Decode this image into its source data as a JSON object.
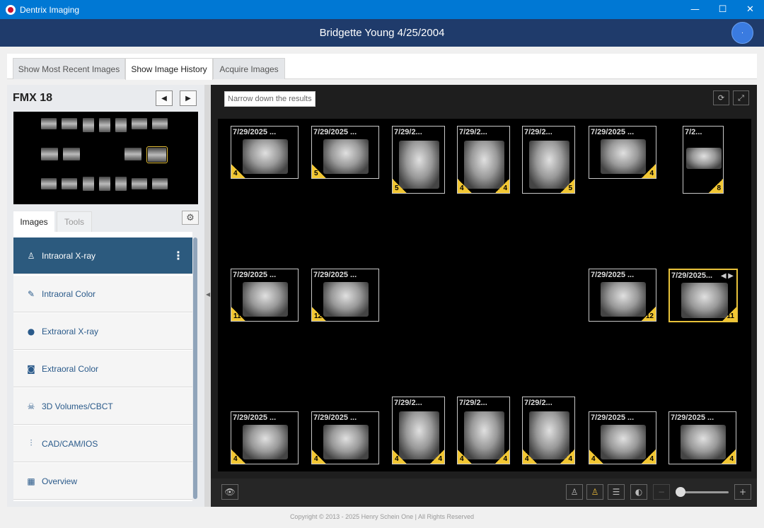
{
  "window": {
    "title": "Dentrix Imaging",
    "minimize": "—",
    "maximize": "☐",
    "close": "✕"
  },
  "patient": {
    "name_dob": "Bridgette Young 4/25/2004",
    "avatar_text": "·"
  },
  "tabs": [
    {
      "label": "Show Most Recent Images"
    },
    {
      "label": "Show Image History"
    },
    {
      "label": "Acquire Images"
    }
  ],
  "fmx": {
    "title": "FMX 18",
    "prev": "◀",
    "next": "▶"
  },
  "panel_tabs": {
    "images": "Images",
    "tools": "Tools",
    "gear": "⚙"
  },
  "categories": [
    {
      "label": "Intraoral X-ray",
      "icon": "tooth-icon",
      "glyph": "♙",
      "menu": "⋮"
    },
    {
      "label": "Intraoral Color",
      "icon": "brush-icon",
      "glyph": "✎"
    },
    {
      "label": "Extraoral X-ray",
      "icon": "head-icon",
      "glyph": "●"
    },
    {
      "label": "Extraoral Color",
      "icon": "camera-icon",
      "glyph": "◙"
    },
    {
      "label": "3D Volumes/CBCT",
      "icon": "skull-icon",
      "glyph": "☠"
    },
    {
      "label": "CAD/CAM/IOS",
      "icon": "implant-icon",
      "glyph": "⫶"
    },
    {
      "label": "Overview",
      "icon": "grid-icon",
      "glyph": "▦"
    }
  ],
  "viewer": {
    "filter_placeholder": "Narrow down the results",
    "refresh": "⟳",
    "fullscreen": "⤢",
    "thumbs": [
      {
        "date": "7/29/2025 ...",
        "bl": "4",
        "br": ""
      },
      {
        "date": "7/29/2025 ...",
        "bl": "5",
        "br": ""
      },
      {
        "date": "7/29/2...",
        "bl": "5",
        "br": ""
      },
      {
        "date": "7/29/2...",
        "bl": "4",
        "br": "4"
      },
      {
        "date": "7/29/2...",
        "bl": "",
        "br": "5"
      },
      {
        "date": "7/29/2025 ...",
        "bl": "",
        "br": "4"
      },
      {
        "date": "7/2...",
        "bl": "",
        "br": "8"
      },
      {
        "date": "7/29/2025 ...",
        "bl": "11",
        "br": ""
      },
      {
        "date": "7/29/2025 ...",
        "bl": "12",
        "br": ""
      },
      {
        "date": "7/29/2025 ...",
        "bl": "",
        "br": "12"
      },
      {
        "date": "7/29/2025...",
        "bl": "",
        "br": "11",
        "arrows": "◀ ▶"
      },
      {
        "date": "7/29/2025 ...",
        "bl": "4",
        "br": ""
      },
      {
        "date": "7/29/2025 ...",
        "bl": "4",
        "br": ""
      },
      {
        "date": "7/29/2...",
        "bl": "4",
        "br": "4"
      },
      {
        "date": "7/29/2...",
        "bl": "4",
        "br": "4"
      },
      {
        "date": "7/29/2...",
        "bl": "4",
        "br": "4"
      },
      {
        "date": "7/29/2025 ...",
        "bl": "4",
        "br": "4"
      },
      {
        "date": "7/29/2025 ...",
        "bl": "",
        "br": "4"
      }
    ]
  },
  "toolbar": {
    "eye": "👁",
    "tooth_outline": "♙",
    "tooth_gold": "♙",
    "sliders": "☰",
    "contrast": "◐",
    "zoom_out": "−",
    "zoom_in": "+",
    "zoom_level": 0.0
  },
  "footer": {
    "copyright": "Copyright © 2013 - 2025 Henry Schein One | All Rights Reserved"
  },
  "colors": {
    "accent": "#0078d4",
    "header": "#1f3b6b",
    "selected": "#e8c23a",
    "badge": "#f2c733"
  }
}
